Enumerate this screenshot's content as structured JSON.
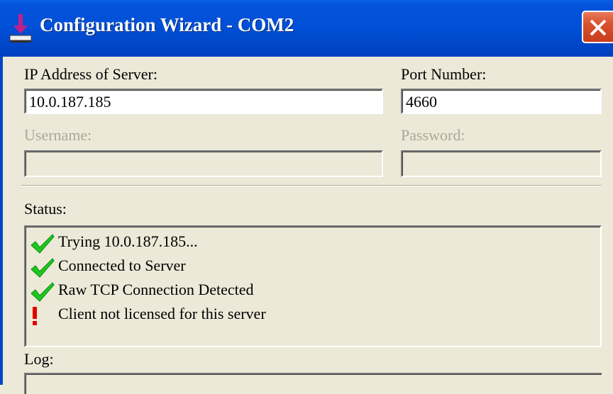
{
  "window": {
    "title": "Configuration Wizard - COM2",
    "app_icon": "download-arrow-icon",
    "close_icon": "close-icon"
  },
  "server": {
    "ip_label": "IP Address of Server:",
    "ip_value": "10.0.187.185",
    "port_label": "Port Number:",
    "port_value": "4660"
  },
  "auth": {
    "username_label": "Username:",
    "username_value": "",
    "password_label": "Password:",
    "password_value": ""
  },
  "status": {
    "label": "Status:",
    "items": [
      {
        "icon": "checkmark-icon",
        "text": "Trying 10.0.187.185..."
      },
      {
        "icon": "checkmark-icon",
        "text": "Connected to Server"
      },
      {
        "icon": "checkmark-icon",
        "text": "Raw TCP Connection Detected"
      },
      {
        "icon": "exclamation-icon",
        "text": "Client not licensed for this server"
      }
    ]
  },
  "log": {
    "label": "Log:"
  },
  "colors": {
    "titlebar": "#0050d8",
    "dialog_bg": "#ece9d8",
    "check": "#1ec81e",
    "alert": "#e00000",
    "close": "#d8512e"
  }
}
